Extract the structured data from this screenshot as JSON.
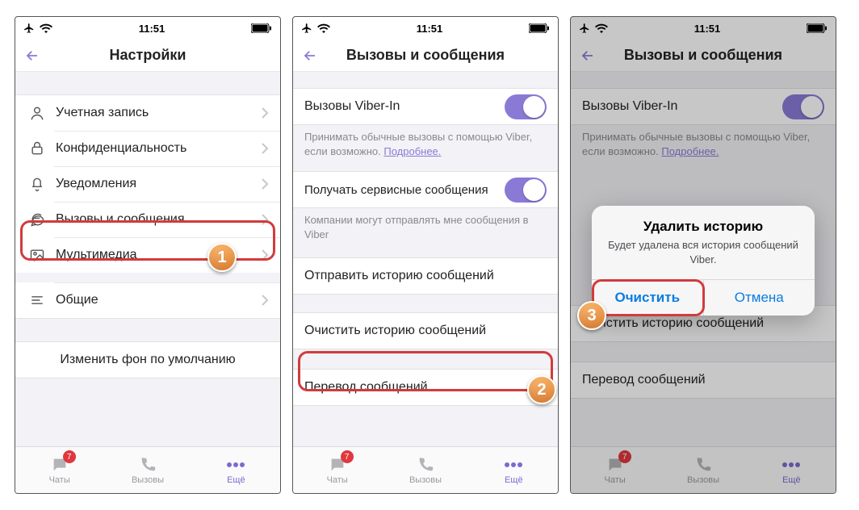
{
  "status": {
    "time": "11:51"
  },
  "screen1": {
    "title": "Настройки",
    "rows": {
      "account": "Учетная запись",
      "privacy": "Конфиденциальность",
      "notifications": "Уведомления",
      "callsmsg": "Вызовы и сообщения",
      "media": "Мультимедиа",
      "general": "Общие",
      "wallpaper": "Изменить фон по умолчанию"
    }
  },
  "screen2": {
    "title": "Вызовы и сообщения",
    "viberin_label": "Вызовы Viber-In",
    "viberin_desc1": "Принимать обычные вызовы с помощью Viber, если возможно. ",
    "viberin_more": "Подробнее.",
    "service_label": "Получать сервисные сообщения",
    "service_desc": "Компании могут отправлять мне сообщения в Viber",
    "send_history": "Отправить историю сообщений",
    "clear_history": "Очистить историю сообщений",
    "translate": "Перевод сообщений"
  },
  "alert": {
    "title": "Удалить историю",
    "message": "Будет удалена вся история сообщений Viber.",
    "confirm": "Очистить",
    "cancel": "Отмена"
  },
  "tabs": {
    "chats": "Чаты",
    "calls": "Вызовы",
    "more": "Ещё",
    "badge": "7"
  },
  "badges": {
    "b1": "1",
    "b2": "2",
    "b3": "3"
  }
}
